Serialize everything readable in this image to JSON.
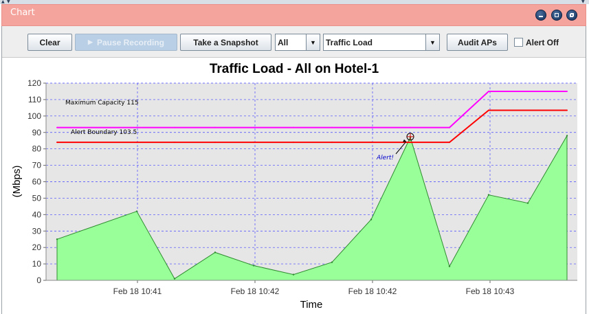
{
  "window": {
    "title": "Chart"
  },
  "toolbar": {
    "clear_label": "Clear",
    "pause_label": "Pause Recording",
    "snapshot_label": "Take a Snapshot",
    "scope_value": "All",
    "metric_value": "Traffic Load",
    "audit_label": "Audit APs",
    "alert_off_label": "Alert Off",
    "alert_off_checked": false
  },
  "chart_data": {
    "type": "area",
    "title": "Traffic Load - All on Hotel-1",
    "xlabel": "Time",
    "ylabel": "(Mbps)",
    "ylim": [
      0,
      120
    ],
    "yticks": [
      0,
      10,
      20,
      30,
      40,
      50,
      60,
      70,
      80,
      90,
      100,
      110,
      120
    ],
    "xtick_labels": [
      "Feb 18 10:41",
      "Feb 18 10:42",
      "Feb 18 10:42",
      "Feb 18 10:43"
    ],
    "grid": true,
    "series": [
      {
        "values": [
          25,
          42,
          1,
          17,
          9,
          3.5,
          11,
          37,
          87,
          8.5,
          52,
          47,
          88
        ],
        "color": "#99ff99",
        "stroke": "#2e8b2e"
      }
    ],
    "thresholds": [
      {
        "label": "Maximum Capacity  115",
        "values_before": 93,
        "values_after": 115,
        "color": "#ff00ff"
      },
      {
        "label": "Alert Boundary 103.5",
        "values_before": 84,
        "values_after": 103.5,
        "color": "#ff0000"
      }
    ],
    "annotation": {
      "text": "Alert!",
      "color": "#0000cc"
    }
  }
}
